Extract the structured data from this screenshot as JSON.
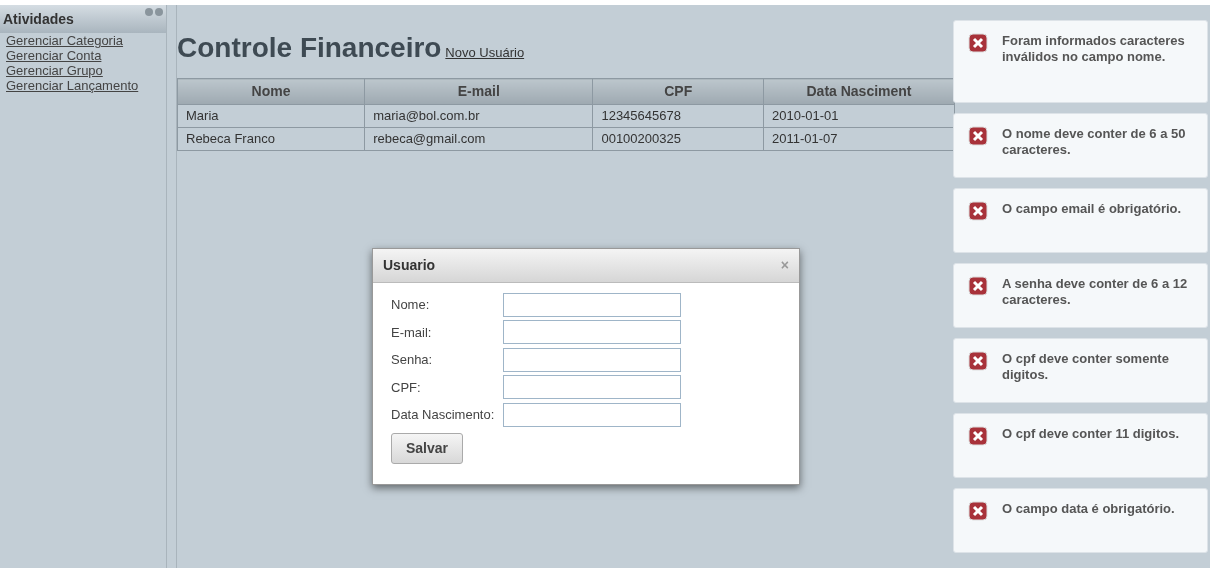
{
  "sidebar": {
    "title": "Atividades",
    "items": [
      {
        "label": "Gerenciar Categoria"
      },
      {
        "label": "Gerenciar Conta"
      },
      {
        "label": "Gerenciar Grupo"
      },
      {
        "label": "Gerenciar Lançamento"
      }
    ]
  },
  "title": "Controle Financeiro",
  "new_link": "Novo Usuário",
  "table": {
    "columns": [
      "Nome",
      "E-mail",
      "CPF",
      "Data Nasciment"
    ],
    "rows": [
      [
        "Maria",
        "maria@bol.com.br",
        "12345645678",
        "2010-01-01"
      ],
      [
        "Rebeca Franco",
        "rebeca@gmail.com",
        "00100200325",
        "2011-01-07"
      ]
    ]
  },
  "dialog": {
    "title": "Usuario",
    "close": "×",
    "fields": [
      {
        "label": "Nome:"
      },
      {
        "label": "E-mail:"
      },
      {
        "label": "Senha:"
      },
      {
        "label": "CPF:"
      },
      {
        "label": "Data Nascimento:"
      }
    ],
    "button": "Salvar"
  },
  "messages": [
    {
      "text": "Foram informados caracteres inválidos no campo nome."
    },
    {
      "text": "O nome deve conter de 6 a 50 caracteres."
    },
    {
      "text": "O campo email é obrigatório."
    },
    {
      "text": "A senha deve conter de 6 a 12 caracteres."
    },
    {
      "text": "O cpf deve conter somente digitos."
    },
    {
      "text": "O cpf deve conter 11 digitos."
    },
    {
      "text": "O campo data é obrigatório."
    }
  ]
}
